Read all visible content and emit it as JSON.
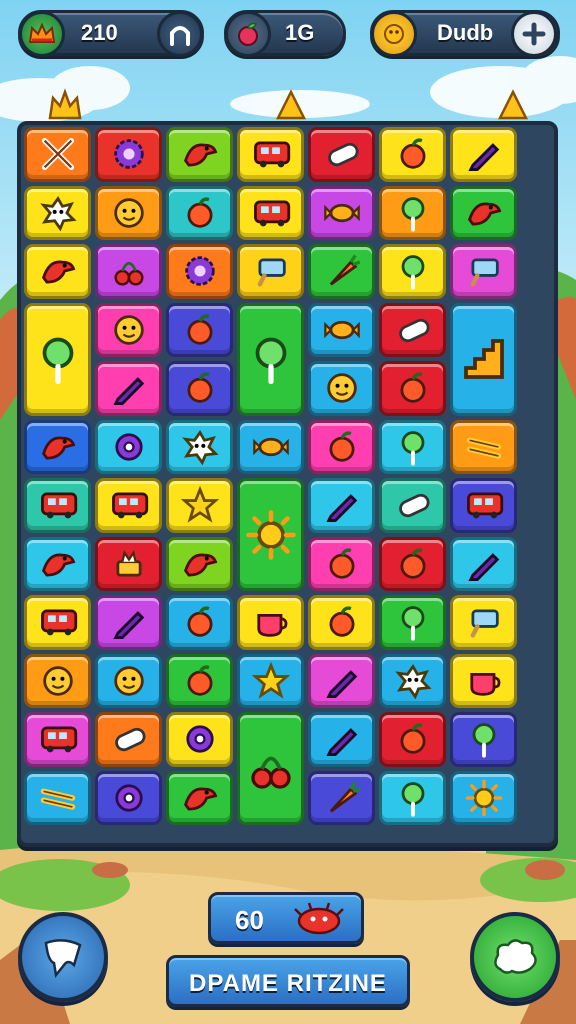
{
  "hud": {
    "left_value": "210",
    "middle_value": "1G",
    "right_value": "Dudb",
    "left_icon": "crown-badge-icon",
    "middle_icon": "apple-icon",
    "right_icon": "coin-icon",
    "nav_icon": "arch-icon",
    "plus_icon": "plus-icon"
  },
  "board": {
    "rows": 11,
    "cols": 7,
    "tiles": [
      {
        "row": 0,
        "col": 0,
        "color": "#ff7a1a",
        "icon": "crossed-sticks"
      },
      {
        "row": 0,
        "col": 1,
        "color": "#e8322a",
        "icon": "gear"
      },
      {
        "row": 0,
        "col": 2,
        "color": "#7fd321",
        "icon": "bird"
      },
      {
        "row": 0,
        "col": 3,
        "color": "#ffe31a",
        "icon": "bus"
      },
      {
        "row": 0,
        "col": 4,
        "color": "#e3202f",
        "icon": "capsule"
      },
      {
        "row": 0,
        "col": 5,
        "color": "#ffe31a",
        "icon": "fruit"
      },
      {
        "row": 0,
        "col": 6,
        "color": "#ffe31a",
        "icon": "pencil"
      },
      {
        "row": 1,
        "col": 0,
        "color": "#ffe31a",
        "icon": "splat"
      },
      {
        "row": 1,
        "col": 1,
        "color": "#ff9b14",
        "icon": "smiley"
      },
      {
        "row": 1,
        "col": 2,
        "color": "#2ec7c9",
        "icon": "fruit"
      },
      {
        "row": 1,
        "col": 3,
        "color": "#ffe31a",
        "icon": "bus"
      },
      {
        "row": 1,
        "col": 4,
        "color": "#c848e6",
        "icon": "candy"
      },
      {
        "row": 1,
        "col": 5,
        "color": "#ff9b14",
        "icon": "lollipop"
      },
      {
        "row": 1,
        "col": 6,
        "color": "#2ec53c",
        "icon": "bird"
      },
      {
        "row": 2,
        "col": 0,
        "color": "#ffe31a",
        "icon": "bird"
      },
      {
        "row": 2,
        "col": 1,
        "color": "#c848e6",
        "icon": "cherry"
      },
      {
        "row": 2,
        "col": 2,
        "color": "#ff7a1a",
        "icon": "gear"
      },
      {
        "row": 2,
        "col": 3,
        "color": "#ffd21a",
        "icon": "popsicle"
      },
      {
        "row": 2,
        "col": 4,
        "color": "#2ec53c",
        "icon": "carrot"
      },
      {
        "row": 2,
        "col": 5,
        "color": "#ffe31a",
        "icon": "lollipop"
      },
      {
        "row": 2,
        "col": 6,
        "color": "#e64bd8",
        "icon": "popsicle"
      },
      {
        "row": 3,
        "col": 0,
        "color": "#ffe31a",
        "icon": "lollipop",
        "rowspan": 2
      },
      {
        "row": 3,
        "col": 1,
        "color": "#ff3fb0",
        "icon": "smiley"
      },
      {
        "row": 3,
        "col": 2,
        "color": "#4a4ad8",
        "icon": "fruit"
      },
      {
        "row": 3,
        "col": 3,
        "color": "#2ec53c",
        "icon": "lollipop",
        "rowspan": 2
      },
      {
        "row": 3,
        "col": 4,
        "color": "#26b2e8",
        "icon": "candy"
      },
      {
        "row": 3,
        "col": 5,
        "color": "#e3202f",
        "icon": "capsule"
      },
      {
        "row": 3,
        "col": 6,
        "color": "#26b2e8",
        "icon": "stairs",
        "rowspan": 2
      },
      {
        "row": 4,
        "col": 1,
        "color": "#ff3fb0",
        "icon": "pencil"
      },
      {
        "row": 4,
        "col": 2,
        "color": "#4a4ad8",
        "icon": "fruit"
      },
      {
        "row": 4,
        "col": 4,
        "color": "#26b2e8",
        "icon": "smiley"
      },
      {
        "row": 4,
        "col": 5,
        "color": "#e3202f",
        "icon": "fruit"
      },
      {
        "row": 5,
        "col": 0,
        "color": "#2a6ee6",
        "icon": "bird"
      },
      {
        "row": 5,
        "col": 1,
        "color": "#2ec7e9",
        "icon": "donut"
      },
      {
        "row": 5,
        "col": 2,
        "color": "#2ec7e9",
        "icon": "splat"
      },
      {
        "row": 5,
        "col": 3,
        "color": "#26b2e8",
        "icon": "candy"
      },
      {
        "row": 5,
        "col": 4,
        "color": "#ff3fb0",
        "icon": "fruit"
      },
      {
        "row": 5,
        "col": 5,
        "color": "#2ec7e9",
        "icon": "lollipop"
      },
      {
        "row": 5,
        "col": 6,
        "color": "#ff9b14",
        "icon": "sticks"
      },
      {
        "row": 6,
        "col": 0,
        "color": "#2ec7a9",
        "icon": "bus"
      },
      {
        "row": 6,
        "col": 1,
        "color": "#ffe31a",
        "icon": "bus"
      },
      {
        "row": 6,
        "col": 2,
        "color": "#ffe31a",
        "icon": "star"
      },
      {
        "row": 6,
        "col": 3,
        "color": "#2ec53c",
        "icon": "sun",
        "rowspan": 2
      },
      {
        "row": 6,
        "col": 4,
        "color": "#2ec7e9",
        "icon": "pencil"
      },
      {
        "row": 6,
        "col": 5,
        "color": "#2ec7a9",
        "icon": "capsule"
      },
      {
        "row": 6,
        "col": 6,
        "color": "#4a4ad8",
        "icon": "bus"
      },
      {
        "row": 7,
        "col": 0,
        "color": "#2ec7e9",
        "icon": "bird"
      },
      {
        "row": 7,
        "col": 1,
        "color": "#e3202f",
        "icon": "cake"
      },
      {
        "row": 7,
        "col": 2,
        "color": "#7fd321",
        "icon": "bird"
      },
      {
        "row": 7,
        "col": 4,
        "color": "#ff3fb0",
        "icon": "fruit"
      },
      {
        "row": 7,
        "col": 5,
        "color": "#e3202f",
        "icon": "fruit"
      },
      {
        "row": 7,
        "col": 6,
        "color": "#2ec7e9",
        "icon": "pencil"
      },
      {
        "row": 8,
        "col": 0,
        "color": "#ffe31a",
        "icon": "bus"
      },
      {
        "row": 8,
        "col": 1,
        "color": "#c848e6",
        "icon": "pencil"
      },
      {
        "row": 8,
        "col": 2,
        "color": "#26b2e8",
        "icon": "fruit"
      },
      {
        "row": 8,
        "col": 3,
        "color": "#ffe31a",
        "icon": "cup"
      },
      {
        "row": 8,
        "col": 4,
        "color": "#ffe31a",
        "icon": "fruit"
      },
      {
        "row": 8,
        "col": 5,
        "color": "#2ec53c",
        "icon": "lollipop"
      },
      {
        "row": 8,
        "col": 6,
        "color": "#ffe31a",
        "icon": "popsicle"
      },
      {
        "row": 9,
        "col": 0,
        "color": "#ff9b14",
        "icon": "smiley"
      },
      {
        "row": 9,
        "col": 1,
        "color": "#26b2e8",
        "icon": "smiley"
      },
      {
        "row": 9,
        "col": 2,
        "color": "#2ec53c",
        "icon": "fruit"
      },
      {
        "row": 9,
        "col": 3,
        "color": "#26b2e8",
        "icon": "star"
      },
      {
        "row": 9,
        "col": 4,
        "color": "#e64bd8",
        "icon": "pencil"
      },
      {
        "row": 9,
        "col": 5,
        "color": "#26b2e8",
        "icon": "splat"
      },
      {
        "row": 9,
        "col": 6,
        "color": "#ffe31a",
        "icon": "cup"
      },
      {
        "row": 10,
        "col": 0,
        "color": "#e64bd8",
        "icon": "bus"
      },
      {
        "row": 10,
        "col": 1,
        "color": "#ff7a1a",
        "icon": "capsule"
      },
      {
        "row": 10,
        "col": 2,
        "color": "#ffe31a",
        "icon": "donut"
      },
      {
        "row": 10,
        "col": 3,
        "color": "#2ec53c",
        "icon": "cherry",
        "rowspan": 2
      },
      {
        "row": 10,
        "col": 4,
        "color": "#26b2e8",
        "icon": "pencil"
      },
      {
        "row": 10,
        "col": 5,
        "color": "#e3202f",
        "icon": "fruit"
      },
      {
        "row": 10,
        "col": 6,
        "color": "#4a4ad8",
        "icon": "lollipop"
      },
      {
        "row": 11,
        "col": 0,
        "color": "#26b2e8",
        "icon": "sticks"
      },
      {
        "row": 11,
        "col": 1,
        "color": "#4a4ad8",
        "icon": "donut"
      },
      {
        "row": 11,
        "col": 2,
        "color": "#2ec53c",
        "icon": "bird"
      },
      {
        "row": 11,
        "col": 4,
        "color": "#4a4ad8",
        "icon": "carrot"
      },
      {
        "row": 11,
        "col": 5,
        "color": "#2ec7e9",
        "icon": "lollipop"
      },
      {
        "row": 11,
        "col": 6,
        "color": "#26b2e8",
        "icon": "sun"
      }
    ]
  },
  "bottom": {
    "counter_value": "60",
    "counter_icon": "red-bird-icon",
    "action_label": "DPAME RITZINE",
    "left_button_icon": "scroll-icon",
    "right_button_icon": "cloud-icon"
  }
}
